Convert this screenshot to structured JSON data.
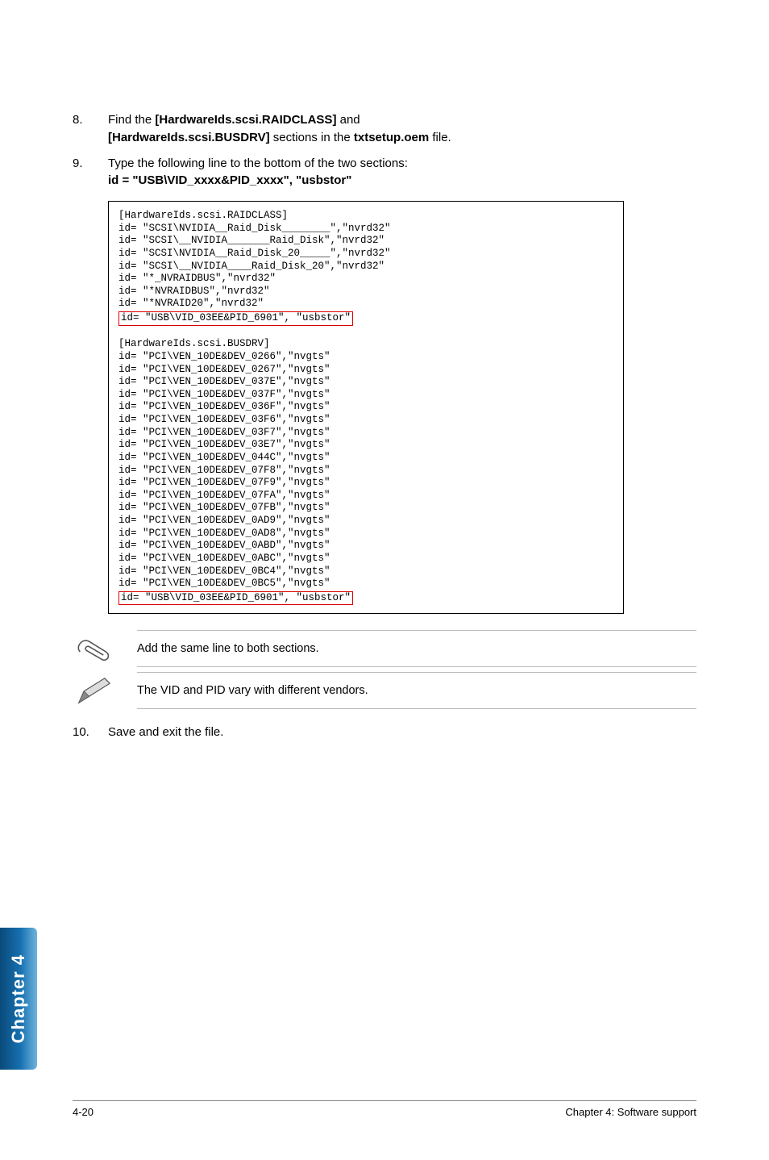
{
  "steps": {
    "s8": {
      "num": "8.",
      "pre": "Find the ",
      "b1": "[HardwareIds.scsi.RAIDCLASS]",
      "mid1": " and ",
      "b2": "[HardwareIds.scsi.BUSDRV]",
      "mid2": " sections in the ",
      "b3": "txtsetup.oem",
      "post": " file."
    },
    "s9": {
      "num": "9.",
      "line1": "Type the following line to the bottom of the two sections:",
      "line2": "id = \"USB\\VID_xxxx&PID_xxxx\", \"usbstor\""
    },
    "s10": {
      "num": "10.",
      "text": "Save and exit the file."
    }
  },
  "code": {
    "block1_lines": "[HardwareIds.scsi.RAIDCLASS]\nid= \"SCSI\\NVIDIA__Raid_Disk________\",\"nvrd32\"\nid= \"SCSI\\__NVIDIA_______Raid_Disk\",\"nvrd32\"\nid= \"SCSI\\NVIDIA__Raid_Disk_20_____\",\"nvrd32\"\nid= \"SCSI\\__NVIDIA____Raid_Disk_20\",\"nvrd32\"\nid= \"*_NVRAIDBUS\",\"nvrd32\"\nid= \"*NVRAIDBUS\",\"nvrd32\"\nid= \"*NVRAID20\",\"nvrd32\"",
    "block1_hl": "id= \"USB\\VID_03EE&PID_6901\", \"usbstor\"",
    "block2_lines": "[HardwareIds.scsi.BUSDRV]\nid= \"PCI\\VEN_10DE&DEV_0266\",\"nvgts\"\nid= \"PCI\\VEN_10DE&DEV_0267\",\"nvgts\"\nid= \"PCI\\VEN_10DE&DEV_037E\",\"nvgts\"\nid= \"PCI\\VEN_10DE&DEV_037F\",\"nvgts\"\nid= \"PCI\\VEN_10DE&DEV_036F\",\"nvgts\"\nid= \"PCI\\VEN_10DE&DEV_03F6\",\"nvgts\"\nid= \"PCI\\VEN_10DE&DEV_03F7\",\"nvgts\"\nid= \"PCI\\VEN_10DE&DEV_03E7\",\"nvgts\"\nid= \"PCI\\VEN_10DE&DEV_044C\",\"nvgts\"\nid= \"PCI\\VEN_10DE&DEV_07F8\",\"nvgts\"\nid= \"PCI\\VEN_10DE&DEV_07F9\",\"nvgts\"\nid= \"PCI\\VEN_10DE&DEV_07FA\",\"nvgts\"\nid= \"PCI\\VEN_10DE&DEV_07FB\",\"nvgts\"\nid= \"PCI\\VEN_10DE&DEV_0AD9\",\"nvgts\"\nid= \"PCI\\VEN_10DE&DEV_0AD8\",\"nvgts\"\nid= \"PCI\\VEN_10DE&DEV_0ABD\",\"nvgts\"\nid= \"PCI\\VEN_10DE&DEV_0ABC\",\"nvgts\"\nid= \"PCI\\VEN_10DE&DEV_0BC4\",\"nvgts\"\nid= \"PCI\\VEN_10DE&DEV_0BC5\",\"nvgts\"",
    "block2_hl": "id= \"USB\\VID_03EE&PID_6901\", \"usbstor\""
  },
  "notes": {
    "n1": "Add the same line to both sections.",
    "n2": "The VID and PID vary with different vendors."
  },
  "tab": "Chapter 4",
  "footer": {
    "left": "4-20",
    "right": "Chapter 4: Software support"
  }
}
